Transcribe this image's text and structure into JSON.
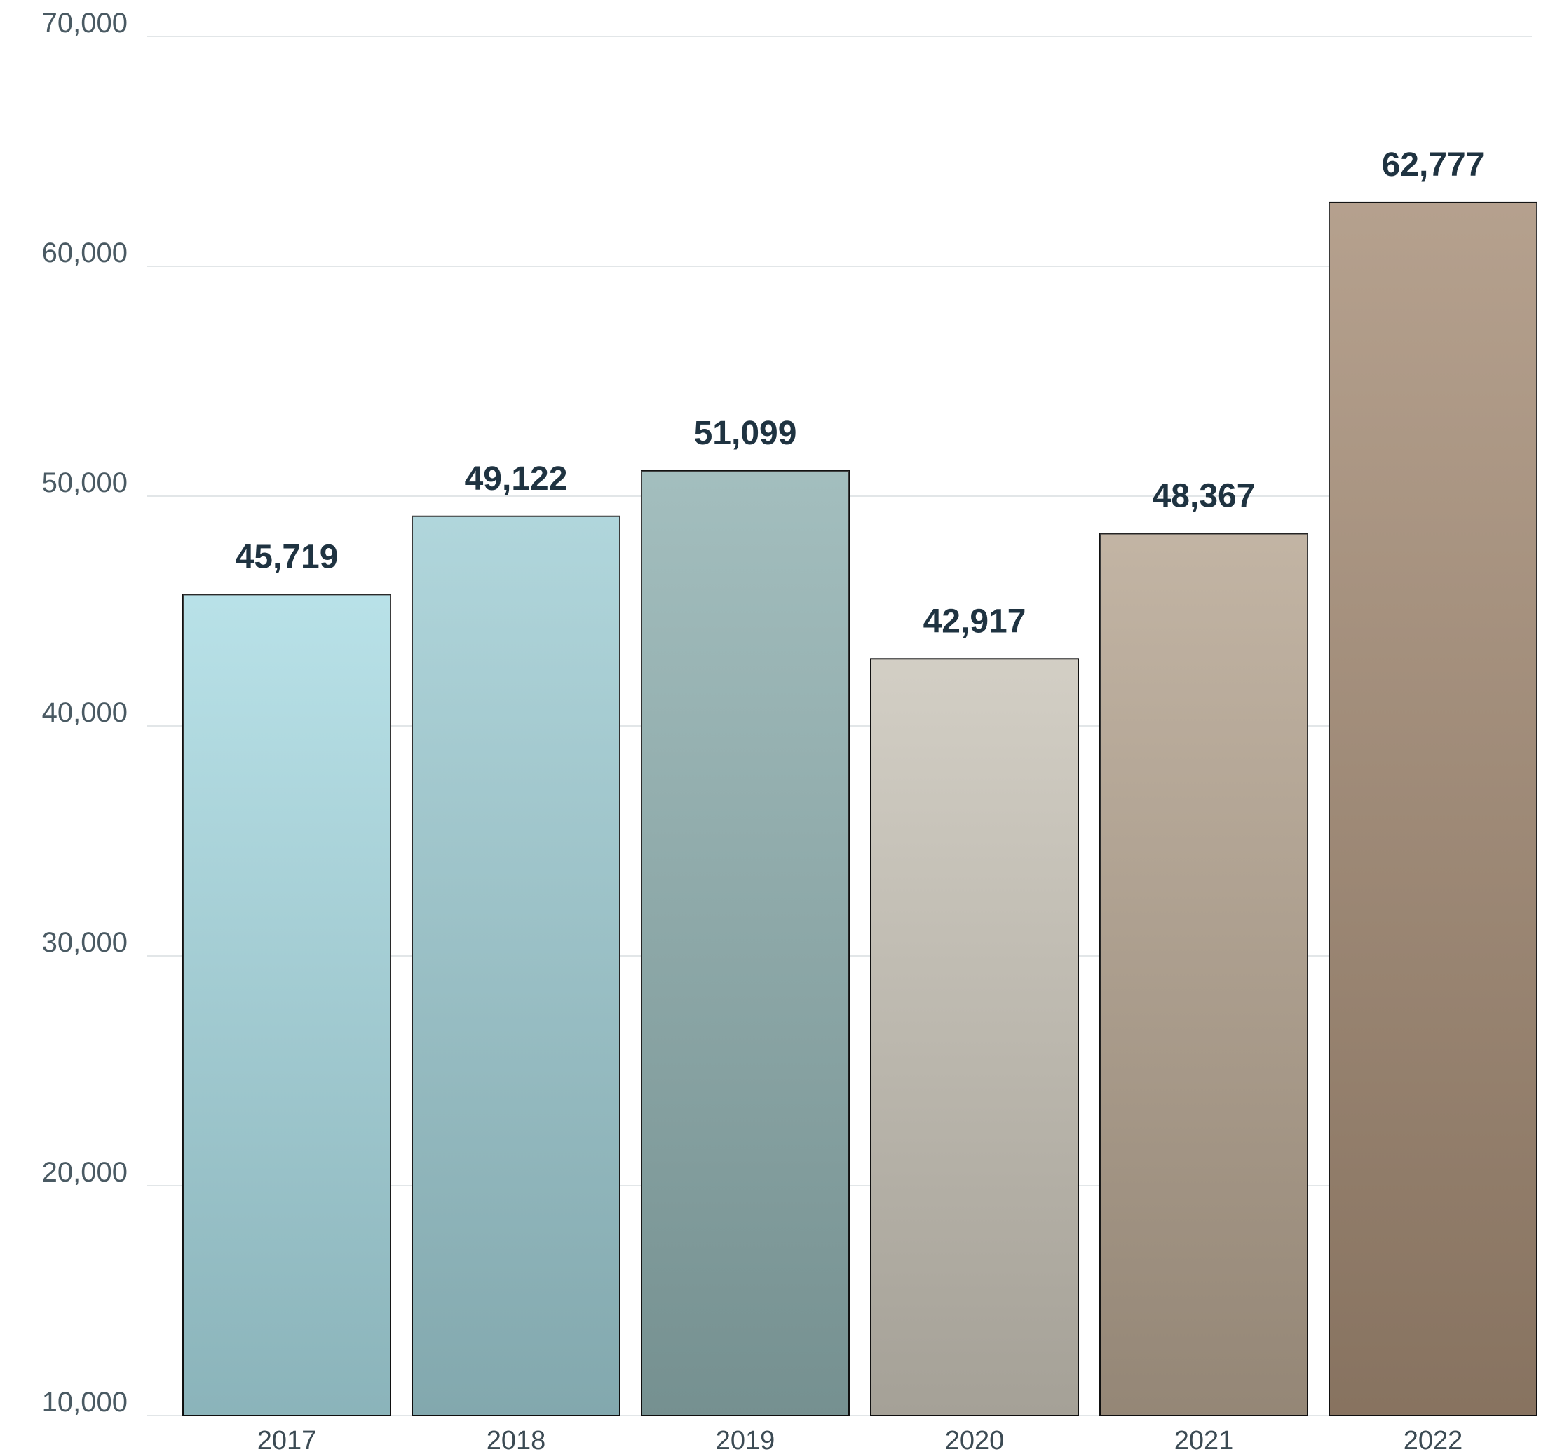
{
  "chart_data": {
    "type": "bar",
    "categories": [
      "2017",
      "2018",
      "2019",
      "2020",
      "2021",
      "2022"
    ],
    "values": [
      45719,
      49122,
      51099,
      42917,
      48367,
      62777
    ],
    "value_labels": [
      "45,719",
      "49,122",
      "51,099",
      "42,917",
      "48,367",
      "62,777"
    ],
    "ylim": [
      10000,
      70000
    ],
    "yticks": [
      10000,
      20000,
      30000,
      40000,
      50000,
      60000,
      70000
    ],
    "ytick_labels": [
      "10,000",
      "20,000",
      "30,000",
      "40,000",
      "50,000",
      "60,000",
      "70,000"
    ],
    "grid": true,
    "bar_colors": [
      "#a9dbe3",
      "#9fcdd4",
      "#8fb0b0",
      "#c9c4b8",
      "#b5a490",
      "#a58c75"
    ],
    "value_label_color": "#1f3341"
  }
}
